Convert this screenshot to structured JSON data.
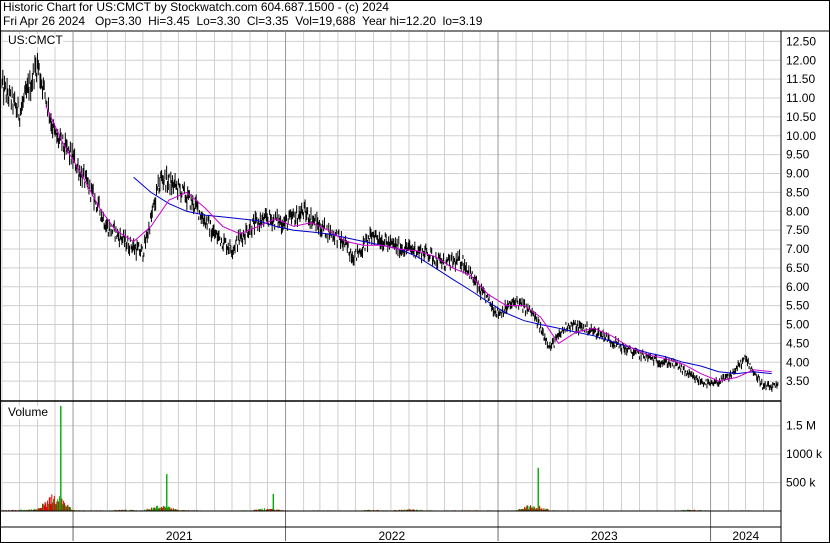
{
  "header": {
    "line1": "Historic Chart for US:CMCT by Stockwatch.com 604.687.1500 - (c) 2024",
    "line2": "Fri Apr 26 2024   Op=3.30  Hi=3.45  Lo=3.30  Cl=3.35  Vol=19,688  Year hi=12.20  lo=3.19"
  },
  "price_panel": {
    "label": "US:CMCT"
  },
  "volume_panel": {
    "label": "Volume"
  },
  "colors": {
    "price_bar": "#000000",
    "ma_short": "#cc00cc",
    "ma_long": "#0000cc",
    "volume_up": "#00aa00",
    "volume_down": "#dd0000",
    "grid": "#d0d0d0",
    "frame": "#000000"
  },
  "chart_data": [
    {
      "type": "line",
      "title": "US:CMCT",
      "x_tick_labels": [
        "2021",
        "2022",
        "2023",
        "2024"
      ],
      "y_tick_labels": [
        "3.50",
        "4.00",
        "4.50",
        "5.00",
        "5.50",
        "6.00",
        "6.50",
        "7.00",
        "7.50",
        "8.00",
        "8.50",
        "9.00",
        "9.50",
        "10.00",
        "10.50",
        "11.00",
        "11.50",
        "12.00",
        "12.50"
      ],
      "ylim": [
        3.0,
        12.75
      ],
      "y_axis_side": "right",
      "grid": true,
      "x": [
        "2020-09-01",
        "2020-10-01",
        "2020-11-01",
        "2020-12-01",
        "2021-01-01",
        "2021-02-01",
        "2021-03-01",
        "2021-04-01",
        "2021-05-01",
        "2021-06-01",
        "2021-07-01",
        "2021-08-01",
        "2021-09-01",
        "2021-10-01",
        "2021-11-01",
        "2021-12-01",
        "2022-01-01",
        "2022-02-01",
        "2022-03-01",
        "2022-04-01",
        "2022-05-01",
        "2022-06-01",
        "2022-07-01",
        "2022-08-01",
        "2022-09-01",
        "2022-10-01",
        "2022-11-01",
        "2022-12-01",
        "2023-01-01",
        "2023-02-01",
        "2023-03-01",
        "2023-04-01",
        "2023-05-01",
        "2023-06-01",
        "2023-07-01",
        "2023-08-01",
        "2023-09-01",
        "2023-10-01",
        "2023-11-01",
        "2023-12-01",
        "2024-01-01",
        "2024-02-01",
        "2024-03-01",
        "2024-04-01"
      ],
      "series": [
        {
          "role": "price",
          "values": [
            11.3,
            10.6,
            11.9,
            10.0,
            9.4,
            8.5,
            7.6,
            7.2,
            6.9,
            8.9,
            8.6,
            8.1,
            7.4,
            7.0,
            7.6,
            7.8,
            7.7,
            8.0,
            7.6,
            7.3,
            6.8,
            7.4,
            7.1,
            7.0,
            6.9,
            6.6,
            6.7,
            5.9,
            5.3,
            5.6,
            5.3,
            4.4,
            5.0,
            4.9,
            4.7,
            4.4,
            4.2,
            4.05,
            3.95,
            3.6,
            3.4,
            3.6,
            4.1,
            3.35
          ]
        },
        {
          "role": "moving_average_short",
          "values": [
            null,
            null,
            10.8,
            9.8,
            9.0,
            8.1,
            7.5,
            7.2,
            7.6,
            8.3,
            8.5,
            8.1,
            7.6,
            7.4,
            7.6,
            7.8,
            7.6,
            7.7,
            7.5,
            7.2,
            7.1,
            7.1,
            7.0,
            6.95,
            6.8,
            6.5,
            6.3,
            5.8,
            5.5,
            5.5,
            5.2,
            4.5,
            4.8,
            4.9,
            4.7,
            4.4,
            4.2,
            4.1,
            3.95,
            3.7,
            3.5,
            3.6,
            3.8,
            3.75
          ]
        },
        {
          "role": "moving_average_long",
          "values": [
            null,
            null,
            null,
            null,
            null,
            null,
            null,
            8.9,
            8.5,
            8.2,
            8.0,
            7.9,
            7.85,
            7.8,
            7.75,
            7.6,
            7.5,
            7.45,
            7.4,
            7.3,
            7.2,
            7.1,
            7.0,
            6.8,
            6.5,
            6.2,
            5.9,
            5.6,
            5.3,
            5.1,
            5.0,
            4.9,
            4.8,
            4.7,
            4.55,
            4.4,
            4.25,
            4.15,
            4.0,
            3.9,
            3.75,
            3.7,
            3.75,
            3.7
          ]
        }
      ]
    },
    {
      "type": "bar",
      "title": "Volume",
      "y_tick_labels": [
        "500 k",
        "1000 k",
        "1.5 M"
      ],
      "ylim": [
        0,
        1900000
      ],
      "y_axis_side": "right",
      "grid": true,
      "x": [
        "2020-09-01",
        "2020-10-01",
        "2020-11-01",
        "2020-12-01",
        "2021-01-01",
        "2021-02-01",
        "2021-03-01",
        "2021-04-01",
        "2021-05-01",
        "2021-06-01",
        "2021-07-01",
        "2021-08-01",
        "2021-09-01",
        "2021-10-01",
        "2021-11-01",
        "2021-12-01",
        "2022-01-01",
        "2022-02-01",
        "2022-03-01",
        "2022-04-01",
        "2022-05-01",
        "2022-06-01",
        "2022-07-01",
        "2022-08-01",
        "2022-09-01",
        "2022-10-01",
        "2022-11-01",
        "2022-12-01",
        "2023-01-01",
        "2023-02-01",
        "2023-03-01",
        "2023-04-01",
        "2023-05-01",
        "2023-06-01",
        "2023-07-01",
        "2023-08-01",
        "2023-09-01",
        "2023-10-01",
        "2023-11-01",
        "2023-12-01",
        "2024-01-01",
        "2024-02-01",
        "2024-03-01",
        "2024-04-01"
      ],
      "values": [
        90000,
        130000,
        210000,
        1850000,
        120000,
        60000,
        80000,
        140000,
        90000,
        650000,
        110000,
        70000,
        60000,
        50000,
        80000,
        300000,
        60000,
        50000,
        70000,
        60000,
        55000,
        120000,
        60000,
        200000,
        70000,
        60000,
        80000,
        75000,
        60000,
        70000,
        760000,
        80000,
        60000,
        50000,
        45000,
        50000,
        60000,
        55000,
        50000,
        150000,
        60000,
        50000,
        70000,
        40000
      ]
    }
  ]
}
